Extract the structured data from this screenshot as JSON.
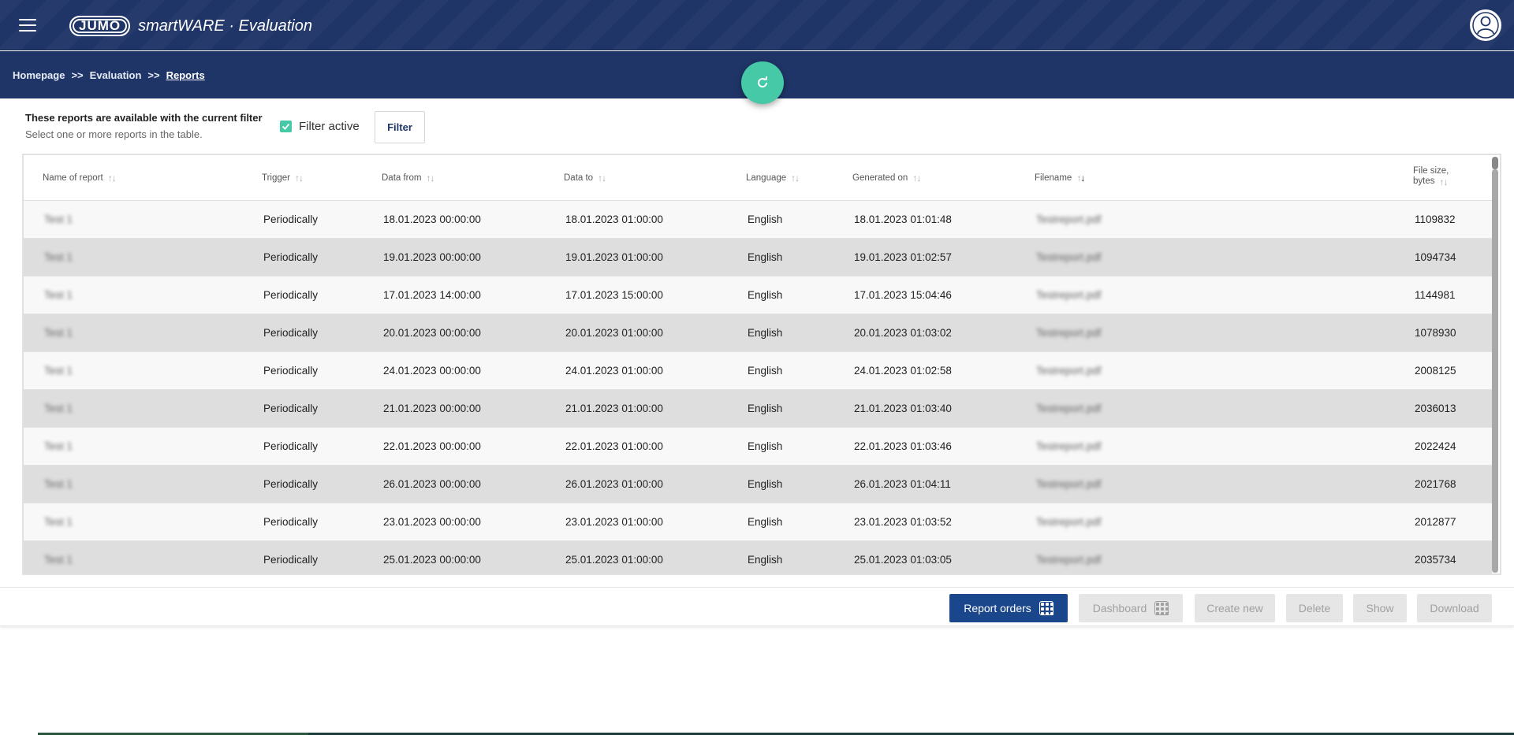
{
  "header": {
    "logo_badge": "JUMO",
    "logo_text": "smartWARE · Evaluation"
  },
  "breadcrumb": {
    "items": [
      "Homepage",
      "Evaluation",
      "Reports"
    ],
    "separator": ">>"
  },
  "filter": {
    "title": "These reports are available with the current filter",
    "subtitle": "Select one or more reports in the table.",
    "filter_active_label": "Filter active",
    "filter_active_checked": true,
    "filter_button": "Filter"
  },
  "table": {
    "columns": {
      "name": "Name of report",
      "trigger": "Trigger",
      "data_from": "Data from",
      "data_to": "Data to",
      "language": "Language",
      "generated_on": "Generated on",
      "filename": "Filename",
      "file_size_1": "File size,",
      "file_size_2": "bytes"
    },
    "rows": [
      {
        "name": "Test 1",
        "trigger": "Periodically",
        "data_from": "18.01.2023 00:00:00",
        "data_to": "18.01.2023 01:00:00",
        "language": "English",
        "generated_on": "18.01.2023 01:01:48",
        "filename": "Testreport.pdf",
        "size": "1109832"
      },
      {
        "name": "Test 1",
        "trigger": "Periodically",
        "data_from": "19.01.2023 00:00:00",
        "data_to": "19.01.2023 01:00:00",
        "language": "English",
        "generated_on": "19.01.2023 01:02:57",
        "filename": "Testreport.pdf",
        "size": "1094734"
      },
      {
        "name": "Test 1",
        "trigger": "Periodically",
        "data_from": "17.01.2023 14:00:00",
        "data_to": "17.01.2023 15:00:00",
        "language": "English",
        "generated_on": "17.01.2023 15:04:46",
        "filename": "Testreport.pdf",
        "size": "1144981"
      },
      {
        "name": "Test 1",
        "trigger": "Periodically",
        "data_from": "20.01.2023 00:00:00",
        "data_to": "20.01.2023 01:00:00",
        "language": "English",
        "generated_on": "20.01.2023 01:03:02",
        "filename": "Testreport.pdf",
        "size": "1078930"
      },
      {
        "name": "Test 1",
        "trigger": "Periodically",
        "data_from": "24.01.2023 00:00:00",
        "data_to": "24.01.2023 01:00:00",
        "language": "English",
        "generated_on": "24.01.2023 01:02:58",
        "filename": "Testreport.pdf",
        "size": "2008125"
      },
      {
        "name": "Test 1",
        "trigger": "Periodically",
        "data_from": "21.01.2023 00:00:00",
        "data_to": "21.01.2023 01:00:00",
        "language": "English",
        "generated_on": "21.01.2023 01:03:40",
        "filename": "Testreport.pdf",
        "size": "2036013"
      },
      {
        "name": "Test 1",
        "trigger": "Periodically",
        "data_from": "22.01.2023 00:00:00",
        "data_to": "22.01.2023 01:00:00",
        "language": "English",
        "generated_on": "22.01.2023 01:03:46",
        "filename": "Testreport.pdf",
        "size": "2022424"
      },
      {
        "name": "Test 1",
        "trigger": "Periodically",
        "data_from": "26.01.2023 00:00:00",
        "data_to": "26.01.2023 01:00:00",
        "language": "English",
        "generated_on": "26.01.2023 01:04:11",
        "filename": "Testreport.pdf",
        "size": "2021768"
      },
      {
        "name": "Test 1",
        "trigger": "Periodically",
        "data_from": "23.01.2023 00:00:00",
        "data_to": "23.01.2023 01:00:00",
        "language": "English",
        "generated_on": "23.01.2023 01:03:52",
        "filename": "Testreport.pdf",
        "size": "2012877"
      },
      {
        "name": "Test 1",
        "trigger": "Periodically",
        "data_from": "25.01.2023 00:00:00",
        "data_to": "25.01.2023 01:00:00",
        "language": "English",
        "generated_on": "25.01.2023 01:03:05",
        "filename": "Testreport.pdf",
        "size": "2035734"
      }
    ]
  },
  "actions": {
    "report_orders": "Report orders",
    "dashboard": "Dashboard",
    "create_new": "Create new",
    "delete": "Delete",
    "show": "Show",
    "download": "Download"
  },
  "colors": {
    "header_bg": "#1f3567",
    "accent": "#45c9a6",
    "primary_button": "#1a468c"
  }
}
